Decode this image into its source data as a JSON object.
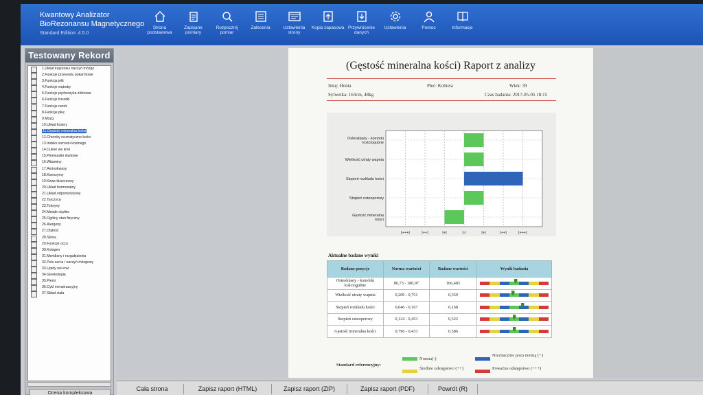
{
  "app": {
    "title1": "Kwantowy Analizator",
    "title2": "BioRezonansu Magnetycznego",
    "edition": "Standard Edition: 4.5.0"
  },
  "nav": [
    {
      "label": "Strona podstawowa",
      "icon": "home-icon"
    },
    {
      "label": "Zapisane pomiary",
      "icon": "clipboard-icon"
    },
    {
      "label": "Rozpocznij pomiar",
      "icon": "magnifier-icon"
    },
    {
      "label": "Zalecenia",
      "icon": "list-icon"
    },
    {
      "label": "Ustawienia strony",
      "icon": "window-icon"
    },
    {
      "label": "Kopia zapasowa",
      "icon": "upload-icon"
    },
    {
      "label": "Przywrócenie danych",
      "icon": "download-icon"
    },
    {
      "label": "Ustawienia",
      "icon": "gear-icon"
    },
    {
      "label": "Pomoc",
      "icon": "user-icon"
    },
    {
      "label": "Informacje",
      "icon": "book-icon"
    }
  ],
  "sidebar": {
    "title": "Testowany Rekord",
    "button": "Ocena kompleksowa",
    "selected_index": 10,
    "items": [
      "1.Układ krążenia i naczyń mózgo",
      "2.Funkcje przewodu pokarmowe",
      "3.Funkcja jelit",
      "4.Funkcje wątroby",
      "5.Funkcje pęcherzyka żółciowe",
      "6.Funkcje trzustki",
      "7.Funkcje nerek",
      "8.Funkcje płuc",
      "9.Mózg",
      "10.Układ kostny",
      "11.Gęstość mineralna kości",
      "12.Choroby reumatyczne kości",
      "13.Indeks wzrostu kostnego",
      "14.Cukier we krwi",
      "15.Pierwiastki śladowe",
      "16.Witaminy",
      "17.Aminokwasy",
      "18.Koenzymy",
      "19.Kwas tłuszczowy",
      "20.Układ hormonalny",
      "21.Układ odpornościowy",
      "22.Tarczyca",
      "23.Toksyny",
      "24.Metale ciężkie",
      "25.Ogólny stan fizyczny",
      "26.Alergeny",
      "27.Otyłość",
      "28.Skóra",
      "29.Funkcje oczu",
      "30.Kolagen",
      "31.Meridiany i rozgałęzienia",
      "32.Puls serca i naczyń mózgowy",
      "33.Lipidy we krwi",
      "34.Ginekologia",
      "35.Piersi",
      "36.Cykl menstruacyjny",
      "37.Skład ciała"
    ]
  },
  "report": {
    "title": "(Gęstość mineralna kości) Raport z analizy",
    "name": "Imię: Honia",
    "gender": "Płeć: Kobieta",
    "age": "Wiek: 39",
    "figure": "Sylwetka: 163cm, 48kg",
    "date": "Czas badania: 2017-05-05 18:15",
    "table_title": "Aktualne badane wyniki",
    "headers": [
      "Badane pozycje",
      "Norma wartości",
      "Badane wartości",
      "Wynik badania"
    ],
    "rows": [
      {
        "name": "Osteoklasty - komórki kościogubne",
        "norm": "86,73 - 180,97",
        "value": "166,483",
        "pos": 0.52
      },
      {
        "name": "Wielkość utraty wapnia",
        "norm": "0,209 - 0,751",
        "value": "0,359",
        "pos": 0.48
      },
      {
        "name": "Stopień rozkładu kości",
        "norm": "0,046 - 0,167",
        "value": "0,168",
        "pos": 0.62
      },
      {
        "name": "Stopień osteoporozy",
        "norm": "0,124 - 0,453",
        "value": "0,322",
        "pos": 0.5
      },
      {
        "name": "Gęstość mineralna kości",
        "norm": "0,796 - 0,433",
        "value": "0,586",
        "pos": 0.5
      }
    ],
    "legend": {
      "label": "Standard referencyjny:",
      "norm": "Norma(-)",
      "slight": "Nieznacznie poza normą (+)",
      "moderate": "Średnie odstępstwo (++)",
      "severe": "Poważne odstępstwo (+++)"
    }
  },
  "chart_data": {
    "type": "bar",
    "orientation": "horizontal",
    "categories": [
      "Osteoklasty - komórki kościogubne",
      "Wielkość utraty wapnia",
      "Stopień rozkładu kości",
      "Stopień osteoporozy",
      "Gęstość mineralna kości"
    ],
    "values": [
      1,
      1,
      3,
      1,
      -1
    ],
    "colors": [
      "#5cc85c",
      "#5cc85c",
      "#2f64b8",
      "#5cc85c",
      "#5cc85c"
    ],
    "x_ticks": [
      "[+++]",
      "[++]",
      "[+]",
      "[-]",
      "[+]",
      "[++]",
      "[+++]"
    ],
    "xlim": [
      -4,
      4
    ],
    "grid": true
  },
  "bottom": [
    "Cała strona",
    "Zapisz raport (HTML)",
    "Zapisz raport (ZIP)",
    "Zapisz raport (PDF)",
    "Powrót (R)"
  ],
  "colors": {
    "topbar": "#2563c4",
    "norm": "#5cc85c",
    "slight": "#2f64b8",
    "moderate": "#e3d43c",
    "severe": "#d63a3a"
  }
}
